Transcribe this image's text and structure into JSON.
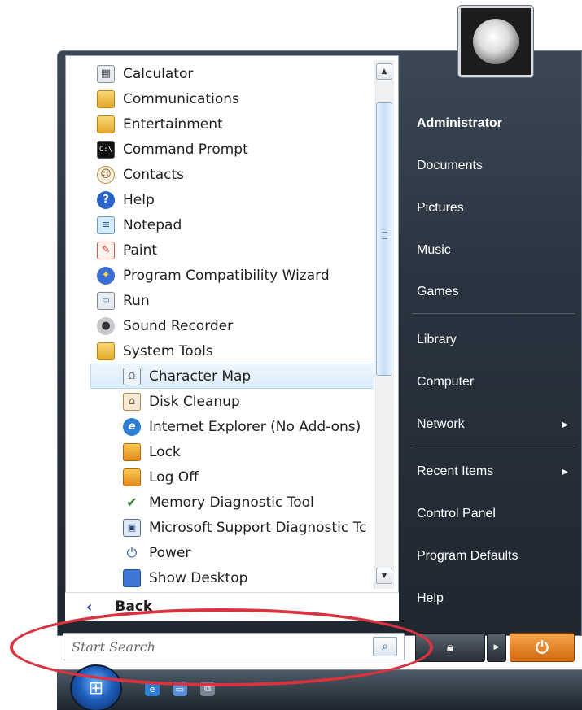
{
  "programs": {
    "items": [
      {
        "label": "Calculator",
        "icon": "calculator-icon",
        "level": 0
      },
      {
        "label": "Communications",
        "icon": "folder-icon",
        "level": 0
      },
      {
        "label": "Entertainment",
        "icon": "folder-icon",
        "level": 0
      },
      {
        "label": "Command Prompt",
        "icon": "command-prompt-icon",
        "level": 0
      },
      {
        "label": "Contacts",
        "icon": "contacts-icon",
        "level": 0
      },
      {
        "label": "Help",
        "icon": "help-icon",
        "level": 0
      },
      {
        "label": "Notepad",
        "icon": "notepad-icon",
        "level": 0
      },
      {
        "label": "Paint",
        "icon": "paint-icon",
        "level": 0
      },
      {
        "label": "Program Compatibility Wizard",
        "icon": "compatibility-wizard-icon",
        "level": 0
      },
      {
        "label": "Run",
        "icon": "run-icon",
        "level": 0
      },
      {
        "label": "Sound Recorder",
        "icon": "microphone-icon",
        "level": 0
      },
      {
        "label": "System Tools",
        "icon": "folder-icon",
        "level": 0
      },
      {
        "label": "Character Map",
        "icon": "character-map-icon",
        "level": 1,
        "selected": true
      },
      {
        "label": "Disk Cleanup",
        "icon": "disk-cleanup-icon",
        "level": 1
      },
      {
        "label": "Internet Explorer (No Add-ons)",
        "icon": "internet-explorer-icon",
        "level": 1
      },
      {
        "label": "Lock",
        "icon": "lock-icon",
        "level": 1
      },
      {
        "label": "Log Off",
        "icon": "log-off-icon",
        "level": 1
      },
      {
        "label": "Memory Diagnostic Tool",
        "icon": "memory-diagnostic-icon",
        "level": 1
      },
      {
        "label": "Microsoft Support Diagnostic Tc",
        "icon": "support-diagnostic-icon",
        "level": 1
      },
      {
        "label": "Power",
        "icon": "power-icon",
        "level": 1
      },
      {
        "label": "Show Desktop",
        "icon": "show-desktop-icon",
        "level": 1
      }
    ],
    "back_label": "Back"
  },
  "search": {
    "placeholder": "Start Search",
    "button_icon": "search-icon"
  },
  "right_pane": {
    "user_name": "Administrator",
    "items": [
      {
        "label": "Documents"
      },
      {
        "label": "Pictures"
      },
      {
        "label": "Music"
      },
      {
        "label": "Games"
      },
      {
        "label": "Library"
      },
      {
        "label": "Computer"
      },
      {
        "label": "Network",
        "submenu": true
      },
      {
        "label": "Recent Items",
        "submenu": true
      },
      {
        "label": "Control Panel"
      },
      {
        "label": "Program Defaults"
      },
      {
        "label": "Help"
      }
    ]
  },
  "colors": {
    "highlight_ellipse": "#d9333f",
    "power_button": "#e07a1f",
    "selected_item_bg": "#dcecfa"
  }
}
